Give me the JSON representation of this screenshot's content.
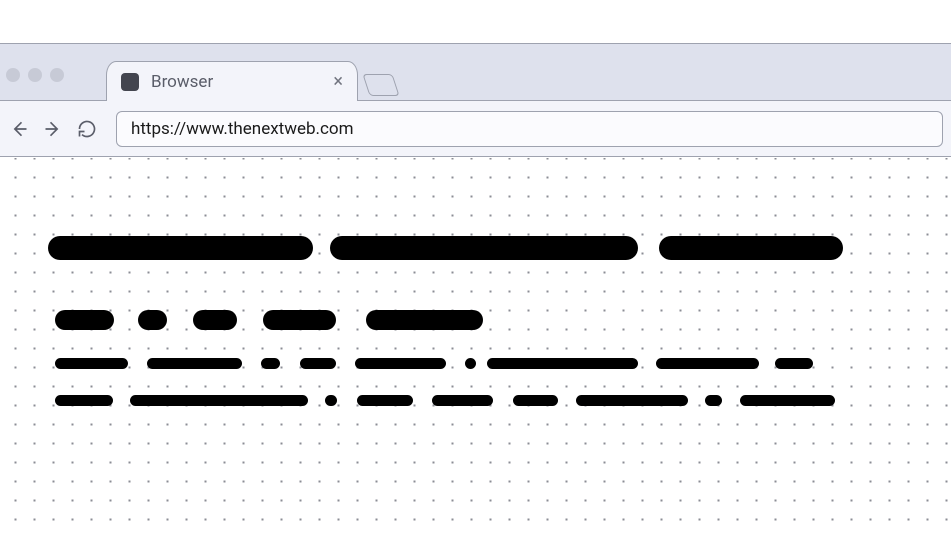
{
  "tab": {
    "title": "Browser"
  },
  "navbar": {
    "url": "https://www.thenextweb.com"
  }
}
